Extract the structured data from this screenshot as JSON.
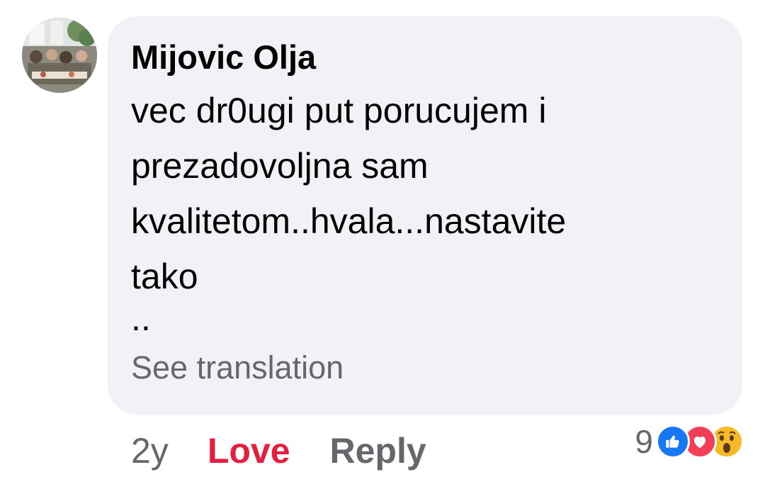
{
  "comment": {
    "author": "Mijovic Olja",
    "text": "vec dr0ugi put porucujem i\nprezadovoljna sam\nkvalitetom..hvala...nastavite\ntako",
    "text_tail": "..",
    "see_translation_label": "See translation"
  },
  "actions": {
    "timestamp": "2y",
    "love_label": "Love",
    "reply_label": "Reply"
  },
  "reactions": {
    "count": "9",
    "icons": [
      "like-icon",
      "love-icon",
      "wow-icon"
    ]
  },
  "colors": {
    "bubble_background": "#f0f2f5",
    "love_red": "#e41e3f",
    "secondary_text": "#65676b",
    "like_blue": "#1877f2"
  }
}
